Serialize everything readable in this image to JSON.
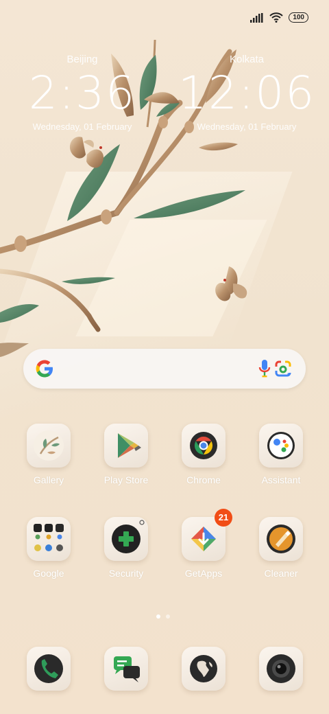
{
  "status_bar": {
    "battery": "100"
  },
  "clocks": [
    {
      "city": "Beijing",
      "time": "2:36",
      "date": "Wednesday, 01 February"
    },
    {
      "city": "Kolkata",
      "time": "12:06",
      "date": "Wednesday, 01 February"
    }
  ],
  "search": {
    "icons": [
      "google-g-icon",
      "microphone-icon",
      "google-lens-icon"
    ]
  },
  "apps_row1": [
    {
      "label": "Gallery"
    },
    {
      "label": "Play Store"
    },
    {
      "label": "Chrome"
    },
    {
      "label": "Assistant"
    }
  ],
  "apps_row2": [
    {
      "label": "Google"
    },
    {
      "label": "Security"
    },
    {
      "label": "GetApps",
      "badge": "21"
    },
    {
      "label": "Cleaner"
    }
  ],
  "dock": [
    {
      "icon": "phone-icon"
    },
    {
      "icon": "messages-icon"
    },
    {
      "icon": "browser-globe-icon"
    },
    {
      "icon": "camera-icon"
    }
  ],
  "page_indicator": {
    "pages": 2,
    "current": 1
  },
  "colors": {
    "background": "#f3e4d0",
    "badge": "#f14d16",
    "label_text": "#ffffff"
  }
}
